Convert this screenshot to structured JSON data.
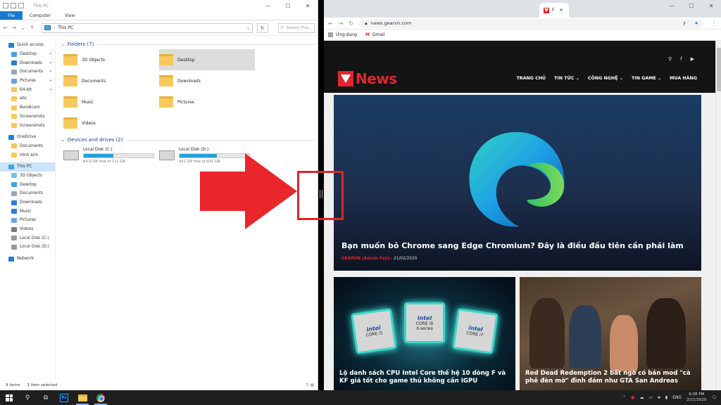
{
  "explorer": {
    "title": "This PC",
    "ribbon_tabs": [
      "File",
      "Computer",
      "View"
    ],
    "address": "This PC",
    "search_placeholder": "Search This...",
    "nav": [
      {
        "label": "Quick access",
        "color": "#2b7cd3",
        "pin": false,
        "sel": false
      },
      {
        "label": "Desktop",
        "color": "#4aa3df",
        "pin": true,
        "sel": false
      },
      {
        "label": "Downloads",
        "color": "#2b7cd3",
        "pin": true,
        "sel": false
      },
      {
        "label": "Documents",
        "color": "#9aa7b4",
        "pin": true,
        "sel": false
      },
      {
        "label": "Pictures",
        "color": "#6fa3d6",
        "pin": true,
        "sel": false
      },
      {
        "label": "64-bit",
        "color": "#f4c95d",
        "pin": true,
        "sel": false
      },
      {
        "label": "abc",
        "color": "#f4c95d",
        "pin": false,
        "sel": false
      },
      {
        "label": "Bandicam",
        "color": "#f4c95d",
        "pin": false,
        "sel": false
      },
      {
        "label": "Screenshots",
        "color": "#f4c95d",
        "pin": false,
        "sel": false
      },
      {
        "label": "Screenshots",
        "color": "#f4c95d",
        "pin": false,
        "sel": false
      },
      {
        "label": "OneDrive",
        "color": "#2b7cd3",
        "pin": false,
        "sel": false
      },
      {
        "label": "Documents",
        "color": "#f4c95d",
        "pin": false,
        "sel": false
      },
      {
        "label": "Hình ảnh",
        "color": "#f4c95d",
        "pin": false,
        "sel": false
      },
      {
        "label": "This PC",
        "color": "#4aa3df",
        "pin": false,
        "sel": true
      },
      {
        "label": "3D Objects",
        "color": "#6fc3e6",
        "pin": false,
        "sel": false
      },
      {
        "label": "Desktop",
        "color": "#4aa3df",
        "pin": false,
        "sel": false
      },
      {
        "label": "Documents",
        "color": "#9aa7b4",
        "pin": false,
        "sel": false
      },
      {
        "label": "Downloads",
        "color": "#2b7cd3",
        "pin": false,
        "sel": false
      },
      {
        "label": "Music",
        "color": "#2b7cd3",
        "pin": false,
        "sel": false
      },
      {
        "label": "Pictures",
        "color": "#6fa3d6",
        "pin": false,
        "sel": false
      },
      {
        "label": "Videos",
        "color": "#7a7a7a",
        "pin": false,
        "sel": false
      },
      {
        "label": "Local Disk (C:)",
        "color": "#9a9a9a",
        "pin": false,
        "sel": false
      },
      {
        "label": "Local Disk (D:)",
        "color": "#9a9a9a",
        "pin": false,
        "sel": false
      },
      {
        "label": "Network",
        "color": "#2b7cd3",
        "pin": false,
        "sel": false
      }
    ],
    "folders_header": "Folders (7)",
    "folders": [
      {
        "label": "3D Objects",
        "sel": false
      },
      {
        "label": "Desktop",
        "sel": true
      },
      {
        "label": "Documents",
        "sel": false
      },
      {
        "label": "Downloads",
        "sel": false
      },
      {
        "label": "Music",
        "sel": false
      },
      {
        "label": "Pictures",
        "sel": false
      },
      {
        "label": "Videos",
        "sel": false
      }
    ],
    "drives_header": "Devices and drives (2)",
    "drives": [
      {
        "label": "Local Disk (C:)",
        "free": "64.0 GB free of 111 GB",
        "used_fraction": 0.42
      },
      {
        "label": "Local Disk (D:)",
        "free": "431 GB free of 931 GB",
        "used_fraction": 0.54
      }
    ],
    "status_items": "9 items",
    "status_selected": "1 item selected"
  },
  "chrome": {
    "tab_title": "F",
    "url": "news.gearvn.com",
    "bookmarks": [
      "Ứng dụng",
      "Gmail"
    ],
    "site": {
      "logo_text": "News",
      "menu": [
        "TRANG CHỦ",
        "TIN TỨC",
        "CÔNG NGHỆ",
        "TIN GAME",
        "MUA HÀNG"
      ],
      "hero_title": "Bạn muốn bỏ Chrome sang Edge Chromium? Đây là điều đầu tiên cần phải làm",
      "hero_author": "GEARVN (Axium Fox)",
      "hero_date": "- 21/02/2020",
      "card1_title": "Lộ danh sách CPU Intel Core thế hệ 10 dòng F và KF giá tốt cho game thủ không cần IGPU",
      "card2_title": "Red Dead Redemption 2 bất ngờ có bản mod \"cà phê đèn mờ\" đình đám như GTA San Andreas",
      "chips": [
        {
          "brand": "intel",
          "line": "CORE i5",
          "sub": ""
        },
        {
          "brand": "intel",
          "line": "CORE i9",
          "sub": "X-series"
        },
        {
          "brand": "intel",
          "line": "CORE i7",
          "sub": ""
        }
      ]
    }
  },
  "taskbar": {
    "lang": "ENG",
    "time": "6:08 PM",
    "date": "2/21/2020"
  },
  "colors": {
    "accent_blue": "#1979ca",
    "brand_red": "#e0262c",
    "annotation_red": "#d9262c"
  }
}
